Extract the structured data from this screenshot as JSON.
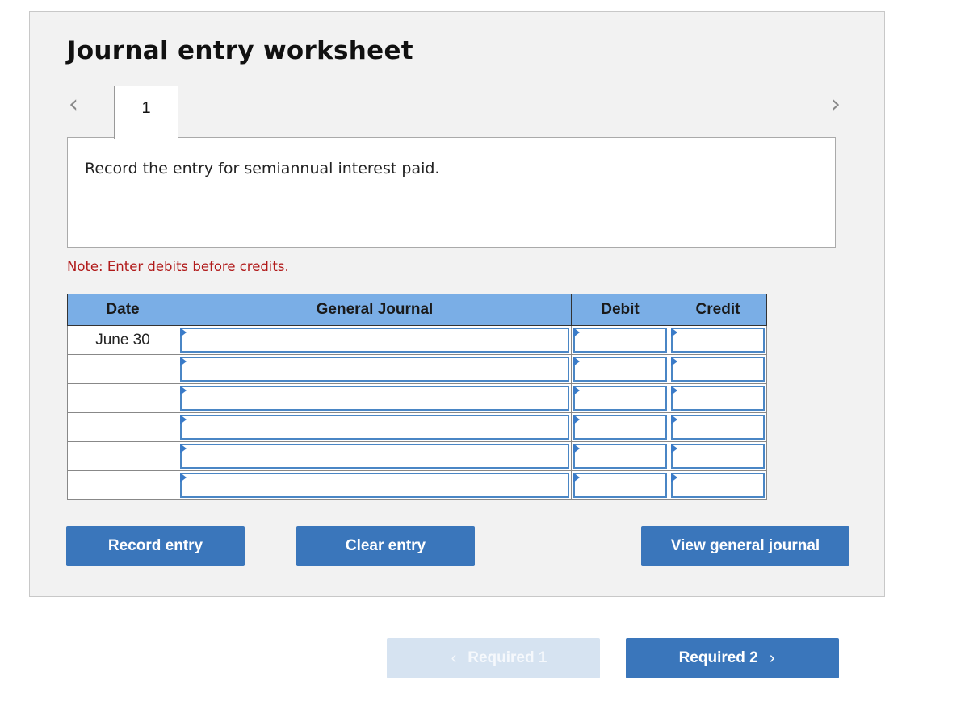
{
  "worksheet": {
    "title": "Journal entry worksheet",
    "prev_icon": "chevron-left-icon",
    "next_icon": "chevron-right-icon",
    "tabs": [
      {
        "label": "1",
        "active": true
      }
    ],
    "prompt": "Record the entry for semiannual interest paid.",
    "note": "Note: Enter debits before credits."
  },
  "journal": {
    "headers": {
      "date": "Date",
      "account": "General Journal",
      "debit": "Debit",
      "credit": "Credit"
    },
    "rows": [
      {
        "date": "June 30",
        "account": "",
        "debit": "",
        "credit": ""
      },
      {
        "date": "",
        "account": "",
        "debit": "",
        "credit": ""
      },
      {
        "date": "",
        "account": "",
        "debit": "",
        "credit": ""
      },
      {
        "date": "",
        "account": "",
        "debit": "",
        "credit": ""
      },
      {
        "date": "",
        "account": "",
        "debit": "",
        "credit": ""
      },
      {
        "date": "",
        "account": "",
        "debit": "",
        "credit": ""
      }
    ]
  },
  "actions": {
    "record": "Record entry",
    "clear": "Clear entry",
    "view": "View general journal"
  },
  "footer_nav": {
    "prev_label": "Required 1",
    "prev_disabled": true,
    "next_label": "Required 2"
  },
  "colors": {
    "header_blue": "#7aaee6",
    "button_blue": "#3a76bb",
    "note_red": "#b11a1a",
    "disabled_button": "#d6e3f1"
  }
}
